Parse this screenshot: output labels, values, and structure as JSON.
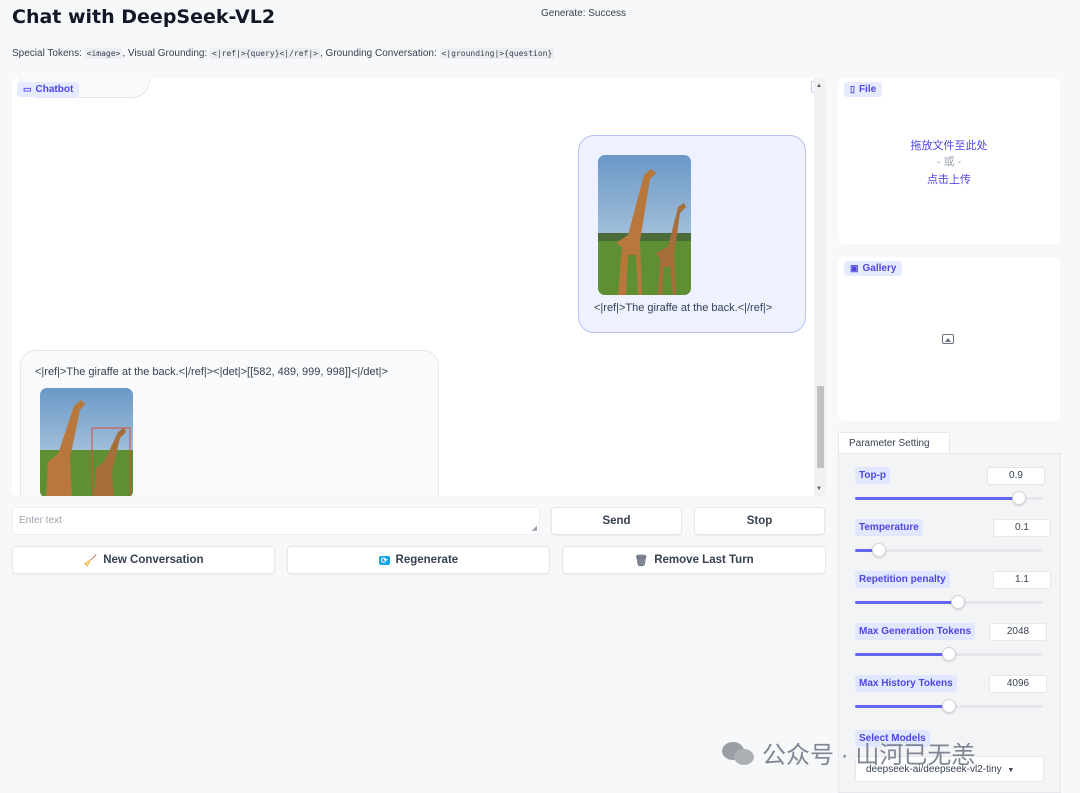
{
  "header": {
    "title": "Chat with DeepSeek-VL2",
    "status": "Generate: Success",
    "tokens_intro": "Special Tokens:",
    "token_image": "<image>",
    "tokens_sep1": ", Visual Grounding:",
    "token_grounding": "<|ref|>{query}<|/ref|>",
    "tokens_sep2": ", Grounding Conversation:",
    "token_conversation": "<|grounding|>{question}"
  },
  "chatbot": {
    "label": "Chatbot",
    "messages": [
      {
        "role": "user",
        "text": "<|ref|>The giraffe at the back.<|/ref|>"
      },
      {
        "role": "assistant",
        "text": "<|ref|>The giraffe at the back.<|/ref|><|det|>[[582, 489, 999, 998]]<|/det|>"
      }
    ]
  },
  "input": {
    "placeholder": "Enter text"
  },
  "buttons": {
    "send": "Send",
    "stop": "Stop",
    "new_conversation": "New Conversation",
    "regenerate": "Regenerate",
    "remove_last_turn": "Remove Last Turn"
  },
  "file_panel": {
    "label": "File",
    "drop_text": "拖放文件至此处",
    "or_text": "- 或 -",
    "click_text": "点击上传"
  },
  "gallery_panel": {
    "label": "Gallery"
  },
  "params": {
    "tab": "Parameter Setting",
    "items": [
      {
        "label": "Top-p",
        "value": "0.9",
        "fraction": 0.87
      },
      {
        "label": "Temperature",
        "value": "0.1",
        "fraction": 0.13
      },
      {
        "label": "Repetition penalty",
        "value": "1.1",
        "fraction": 0.55
      },
      {
        "label": "Max Generation Tokens",
        "value": "2048",
        "fraction": 0.5
      },
      {
        "label": "Max History Tokens",
        "value": "4096",
        "fraction": 0.5
      }
    ],
    "model_label": "Select Models",
    "model_value": "deepseek-ai/deepseek-vl2-tiny"
  },
  "watermark": {
    "text": "公众号 · 山河已无恙"
  },
  "colors": {
    "accent": "#6366f1",
    "label_bg": "#e0e7ff",
    "user_bubble": "#eef1ff"
  }
}
